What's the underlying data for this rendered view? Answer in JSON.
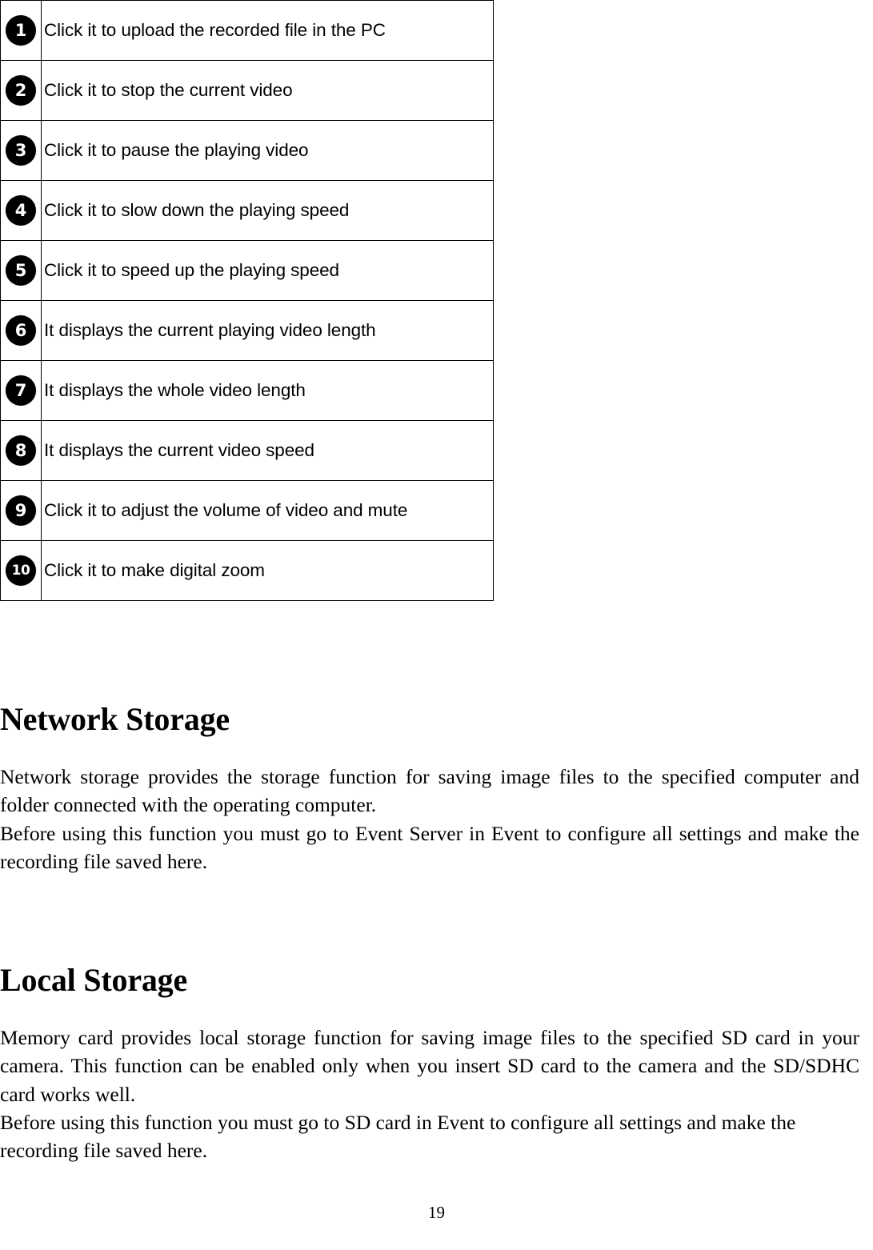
{
  "legend_table": {
    "rows": [
      {
        "number": "1",
        "description": "Click it to upload the recorded file in the PC"
      },
      {
        "number": "2",
        "description": "Click it to stop the current video"
      },
      {
        "number": "3",
        "description": "Click it to pause the playing video"
      },
      {
        "number": "4",
        "description": "Click it to slow down the playing speed"
      },
      {
        "number": "5",
        "description": "Click it to speed up the playing speed"
      },
      {
        "number": "6",
        "description": "It displays the current playing video length"
      },
      {
        "number": "7",
        "description": "It displays the whole video length"
      },
      {
        "number": "8",
        "description": "It displays the current video speed"
      },
      {
        "number": "9",
        "description": "Click it to adjust the volume of video and mute"
      },
      {
        "number": "10",
        "description": "Click it to make digital zoom"
      }
    ]
  },
  "sections": {
    "network_storage": {
      "heading": "Network Storage",
      "paragraph_1": "Network storage provides the storage function for saving image files to the specified computer and folder connected with the operating computer.",
      "paragraph_2": "Before using this function you must go to Event Server in Event to configure all settings and make the recording file saved here."
    },
    "local_storage": {
      "heading": "Local Storage",
      "paragraph_1": "Memory card provides local storage function for saving image files to the specified SD card in your camera. This function can be enabled only when you insert SD card to the camera and the SD/SDHC card works well.",
      "paragraph_2": "Before using this function you must go to SD card in Event to configure all settings and make the recording file saved here."
    }
  },
  "footer": {
    "page_number": "19"
  }
}
